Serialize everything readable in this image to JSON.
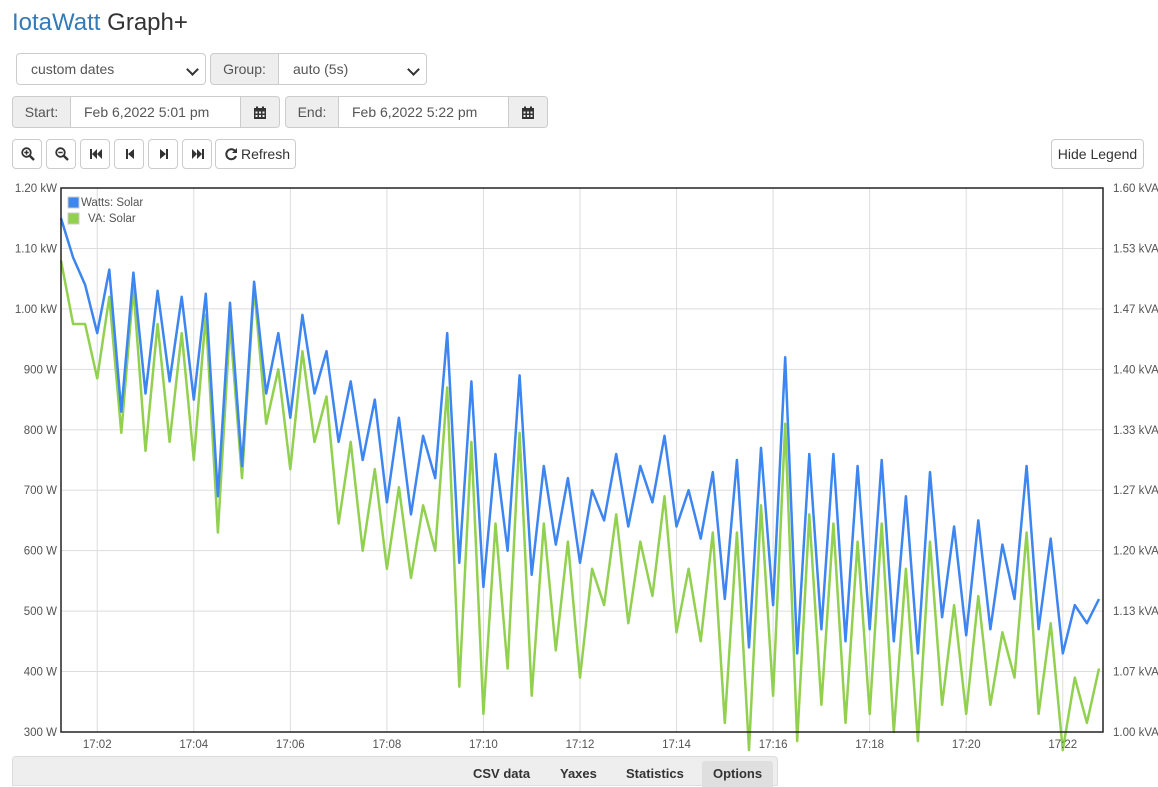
{
  "app": {
    "brand": "IotaWatt",
    "title_rest": "Graph+"
  },
  "controls": {
    "period": {
      "value": "custom dates"
    },
    "group": {
      "label": "Group:",
      "value": "auto (5s)"
    },
    "start": {
      "label": "Start:",
      "value": "Feb 6,2022 5:01 pm"
    },
    "end": {
      "label": "End:",
      "value": "Feb 6,2022 5:22 pm"
    },
    "refresh_label": "Refresh",
    "hide_legend_label": "Hide Legend",
    "icons": [
      "zoom-in-icon",
      "zoom-out-icon",
      "fast-backward-icon",
      "step-backward-icon",
      "step-forward-icon",
      "fast-forward-icon",
      "refresh-icon",
      "calendar-icon"
    ]
  },
  "tabs": [
    {
      "label": "CSV data",
      "active": false
    },
    {
      "label": "Yaxes",
      "active": false
    },
    {
      "label": "Statistics",
      "active": false
    },
    {
      "label": "Options",
      "active": true
    }
  ],
  "chart_data": {
    "type": "line",
    "grid": true,
    "legend_position": "top-left",
    "xlim": [
      "17:01:15",
      "17:22:50"
    ],
    "x_ticks": [
      "17:02",
      "17:04",
      "17:06",
      "17:08",
      "17:10",
      "17:12",
      "17:14",
      "17:16",
      "17:18",
      "17:20",
      "17:22"
    ],
    "y_left": {
      "unit": "W",
      "range": [
        300,
        1200
      ],
      "ticks": [
        "1.20 kW",
        "1.10 kW",
        "1.00 kW",
        "900 W",
        "800 W",
        "700 W",
        "600 W",
        "500 W",
        "400 W",
        "300 W"
      ]
    },
    "y_right": {
      "unit": "kVA",
      "range": [
        1.0,
        1.6
      ],
      "ticks": [
        "1.60 kVA",
        "1.53 kVA",
        "1.47 kVA",
        "1.40 kVA",
        "1.33 kVA",
        "1.27 kVA",
        "1.20 kVA",
        "1.13 kVA",
        "1.07 kVA",
        "1.00 kVA"
      ]
    },
    "series": [
      {
        "name": "Watts: Solar",
        "axis": "left",
        "color": "#3d85f0",
        "x": [
          "17:01:15",
          "17:01:30",
          "17:01:45",
          "17:02:00",
          "17:02:15",
          "17:02:30",
          "17:02:45",
          "17:03:00",
          "17:03:15",
          "17:03:30",
          "17:03:45",
          "17:04:00",
          "17:04:15",
          "17:04:30",
          "17:04:45",
          "17:05:00",
          "17:05:15",
          "17:05:30",
          "17:05:45",
          "17:06:00",
          "17:06:15",
          "17:06:30",
          "17:06:45",
          "17:07:00",
          "17:07:15",
          "17:07:30",
          "17:07:45",
          "17:08:00",
          "17:08:15",
          "17:08:30",
          "17:08:45",
          "17:09:00",
          "17:09:15",
          "17:09:30",
          "17:09:45",
          "17:10:00",
          "17:10:15",
          "17:10:30",
          "17:10:45",
          "17:11:00",
          "17:11:15",
          "17:11:30",
          "17:11:45",
          "17:12:00",
          "17:12:15",
          "17:12:30",
          "17:12:45",
          "17:13:00",
          "17:13:15",
          "17:13:30",
          "17:13:45",
          "17:14:00",
          "17:14:15",
          "17:14:30",
          "17:14:45",
          "17:15:00",
          "17:15:15",
          "17:15:30",
          "17:15:45",
          "17:16:00",
          "17:16:15",
          "17:16:30",
          "17:16:45",
          "17:17:00",
          "17:17:15",
          "17:17:30",
          "17:17:45",
          "17:18:00",
          "17:18:15",
          "17:18:30",
          "17:18:45",
          "17:19:00",
          "17:19:15",
          "17:19:30",
          "17:19:45",
          "17:20:00",
          "17:20:15",
          "17:20:30",
          "17:20:45",
          "17:21:00",
          "17:21:15",
          "17:21:30",
          "17:21:45",
          "17:22:00",
          "17:22:15",
          "17:22:30",
          "17:22:45"
        ],
        "values": [
          1150,
          1085,
          1040,
          960,
          1065,
          830,
          1060,
          860,
          1030,
          880,
          1020,
          850,
          1025,
          690,
          1010,
          740,
          1045,
          860,
          960,
          820,
          990,
          860,
          930,
          780,
          880,
          750,
          850,
          680,
          820,
          660,
          790,
          720,
          960,
          580,
          880,
          540,
          760,
          600,
          890,
          560,
          740,
          610,
          720,
          580,
          700,
          650,
          760,
          640,
          740,
          680,
          790,
          640,
          700,
          620,
          730,
          520,
          750,
          440,
          770,
          510,
          920,
          430,
          760,
          470,
          760,
          450,
          740,
          470,
          750,
          450,
          690,
          430,
          730,
          490,
          640,
          460,
          650,
          470,
          610,
          520,
          740,
          470,
          620,
          430,
          510,
          480,
          520
        ]
      },
      {
        "name": "VA: Solar",
        "axis": "right",
        "color": "#92d050",
        "x": [
          "17:01:15",
          "17:01:30",
          "17:01:45",
          "17:02:00",
          "17:02:15",
          "17:02:30",
          "17:02:45",
          "17:03:00",
          "17:03:15",
          "17:03:30",
          "17:03:45",
          "17:04:00",
          "17:04:15",
          "17:04:30",
          "17:04:45",
          "17:05:00",
          "17:05:15",
          "17:05:30",
          "17:05:45",
          "17:06:00",
          "17:06:15",
          "17:06:30",
          "17:06:45",
          "17:07:00",
          "17:07:15",
          "17:07:30",
          "17:07:45",
          "17:08:00",
          "17:08:15",
          "17:08:30",
          "17:08:45",
          "17:09:00",
          "17:09:15",
          "17:09:30",
          "17:09:45",
          "17:10:00",
          "17:10:15",
          "17:10:30",
          "17:10:45",
          "17:11:00",
          "17:11:15",
          "17:11:30",
          "17:11:45",
          "17:12:00",
          "17:12:15",
          "17:12:30",
          "17:12:45",
          "17:13:00",
          "17:13:15",
          "17:13:30",
          "17:13:45",
          "17:14:00",
          "17:14:15",
          "17:14:30",
          "17:14:45",
          "17:15:00",
          "17:15:15",
          "17:15:30",
          "17:15:45",
          "17:16:00",
          "17:16:15",
          "17:16:30",
          "17:16:45",
          "17:17:00",
          "17:17:15",
          "17:17:30",
          "17:17:45",
          "17:18:00",
          "17:18:15",
          "17:18:30",
          "17:18:45",
          "17:19:00",
          "17:19:15",
          "17:19:30",
          "17:19:45",
          "17:20:00",
          "17:20:15",
          "17:20:30",
          "17:20:45",
          "17:21:00",
          "17:21:15",
          "17:21:30",
          "17:21:45",
          "17:22:00",
          "17:22:15",
          "17:22:30",
          "17:22:45"
        ],
        "values": [
          1.52,
          1.45,
          1.45,
          1.39,
          1.48,
          1.33,
          1.49,
          1.31,
          1.45,
          1.32,
          1.44,
          1.3,
          1.46,
          1.22,
          1.45,
          1.28,
          1.49,
          1.34,
          1.4,
          1.29,
          1.42,
          1.32,
          1.37,
          1.23,
          1.32,
          1.2,
          1.29,
          1.18,
          1.27,
          1.17,
          1.25,
          1.2,
          1.38,
          1.05,
          1.32,
          1.02,
          1.23,
          1.07,
          1.33,
          1.04,
          1.23,
          1.09,
          1.21,
          1.06,
          1.18,
          1.14,
          1.24,
          1.12,
          1.21,
          1.15,
          1.26,
          1.11,
          1.18,
          1.1,
          1.22,
          1.01,
          1.22,
          0.98,
          1.25,
          1.04,
          1.34,
          0.99,
          1.24,
          1.03,
          1.23,
          1.01,
          1.21,
          1.02,
          1.23,
          1.0,
          1.18,
          0.99,
          1.21,
          1.03,
          1.14,
          1.02,
          1.15,
          1.03,
          1.11,
          1.06,
          1.22,
          1.02,
          1.12,
          0.98,
          1.06,
          1.01,
          1.07
        ]
      }
    ]
  }
}
